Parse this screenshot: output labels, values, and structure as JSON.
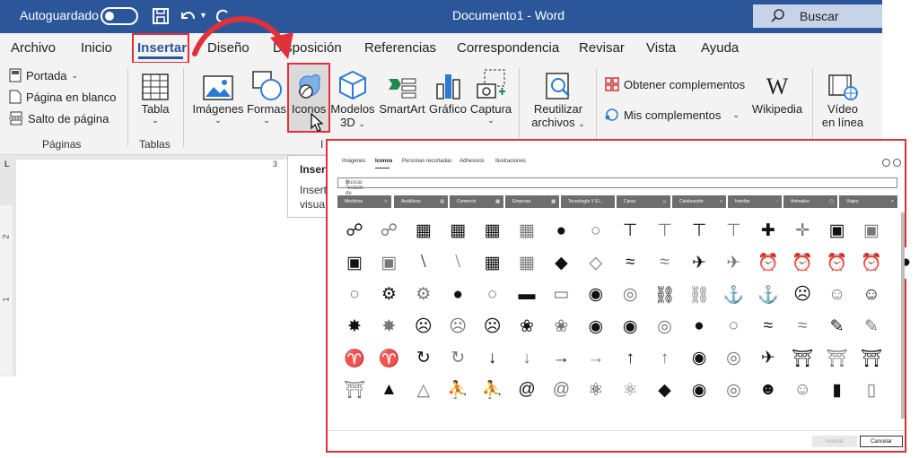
{
  "titlebar": {
    "autosave_label": "Autoguardado",
    "document_title": "Documento1  -  Word",
    "search_label": "Buscar"
  },
  "tabs": [
    "Archivo",
    "Inicio",
    "Insertar",
    "Diseño",
    "Disposición",
    "Referencias",
    "Correspondencia",
    "Revisar",
    "Vista",
    "Ayuda"
  ],
  "active_tab": "Insertar",
  "ribbon": {
    "pages_group": {
      "cover": "Portada",
      "blank": "Página en blanco",
      "break": "Salto de página",
      "label": "Páginas"
    },
    "table": {
      "label": "Tabla",
      "group": "Tablas"
    },
    "images": "Imágenes",
    "shapes": "Formas",
    "icons": "Iconos",
    "models_line1": "Modelos",
    "models_line2": "3D",
    "smartart": "SmartArt",
    "chart": "Gráfico",
    "capture": "Captura",
    "reuse_line1": "Reutilizar",
    "reuse_line2": "archivos",
    "get_addins": "Obtener complementos",
    "my_addins": "Mis complementos",
    "wikipedia": "Wikipedia",
    "video_line1": "Vídeo",
    "video_line2": "en línea",
    "illus_group_partial": "I"
  },
  "tooltip": {
    "title": "Inser",
    "line1": "Insert",
    "line2": "visua"
  },
  "ruler": {
    "top_mark": "3",
    "corner": "L",
    "v1": "2",
    "v2": "1"
  },
  "dialog": {
    "tabs": [
      "Imágenes",
      "Iconos",
      "Personas recortadas",
      "Adhesivos",
      "Ilustraciones"
    ],
    "active_tab": "Iconos",
    "search_placeholder": "Buscar \"estado de ánimo\"",
    "categories": [
      "Medicina",
      "Analíticos",
      "Comercio",
      "Empresa",
      "Tecnología Y El...",
      "Caras",
      "Celebración",
      "Interfaz",
      "Animales",
      "Viajes"
    ],
    "insert_label": "Insertar",
    "cancel_label": "Cancelar"
  },
  "colors": {
    "accent": "#2b579a",
    "highlight": "#e0303a"
  }
}
